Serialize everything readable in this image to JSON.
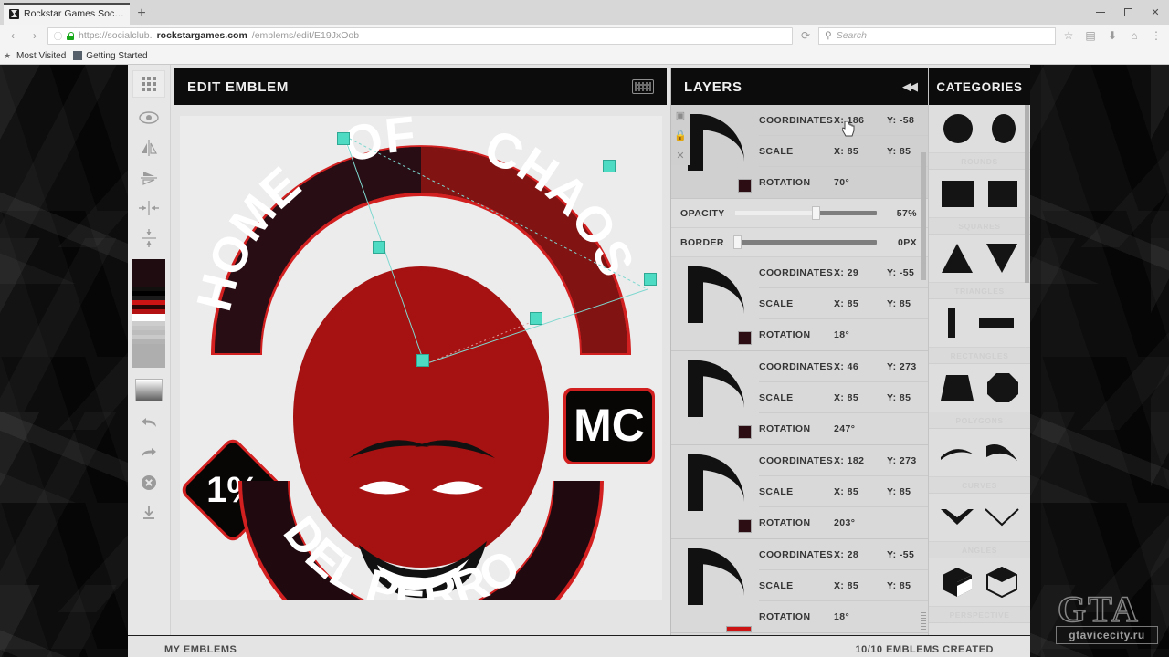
{
  "browser": {
    "tab_title": "Rockstar Games Social Club",
    "new_tab_label": "+",
    "url_scheme": "https://socialclub.",
    "url_host": "rockstargames.com",
    "url_path": "/emblems/edit/E19JxOob",
    "search_placeholder": "Search",
    "reload_icon": "reload-icon",
    "bookmarks": [
      {
        "label": "Most Visited",
        "icon": "star-icon"
      },
      {
        "label": "Getting Started",
        "icon": "bookmark-folder-icon"
      }
    ]
  },
  "editor": {
    "title": "EDIT EMBLEM",
    "keyboard_icon": "keyboard-icon",
    "tools": [
      {
        "name": "grid-toggle",
        "icon": "grid-icon"
      },
      {
        "name": "visibility-toggle",
        "icon": "eye-icon"
      },
      {
        "name": "flip-horizontal",
        "icon": "flip-horizontal-icon"
      },
      {
        "name": "flip-vertical",
        "icon": "flip-vertical-icon"
      },
      {
        "name": "align-center-horizontal",
        "icon": "align-center-horizontal-icon"
      },
      {
        "name": "align-center-vertical",
        "icon": "align-center-vertical-icon"
      }
    ],
    "swatches": [
      "#1e0c10",
      "#12100f",
      "#000000",
      "#cc1414",
      "#b41212",
      "#ffffff",
      "#c9c9c9",
      "#bdbdbd",
      "#b2b2b2",
      "#a8a8a8",
      "#9f9f9f"
    ],
    "gradient_button": "gradient-picker",
    "actions": [
      {
        "name": "undo",
        "icon": "undo-icon"
      },
      {
        "name": "redo",
        "icon": "redo-icon"
      },
      {
        "name": "clear",
        "icon": "clear-circle-icon"
      },
      {
        "name": "download",
        "icon": "download-icon"
      }
    ]
  },
  "emblem": {
    "top_arc_text": "HOME",
    "top_center_text": "OF",
    "top_right_text": "CHAOS",
    "badge_left": "1%",
    "badge_right": "MC",
    "bottom_arc_text": "DEL PERRO",
    "colors": {
      "red": "#a61111",
      "dark": "#1b0a0f",
      "outline": "#d21f1f",
      "canvas": "#ececed"
    }
  },
  "layers": {
    "title": "LAYERS",
    "collapse_icon": "collapse-left-icon",
    "controls": [
      {
        "name": "duplicate-layer",
        "icon": "duplicate-icon"
      },
      {
        "name": "lock-layer",
        "icon": "lock-icon"
      },
      {
        "name": "delete-layer",
        "icon": "close-icon"
      }
    ],
    "labels": {
      "coordinates": "COORDINATES",
      "scale": "SCALE",
      "rotation": "ROTATION",
      "opacity": "OPACITY",
      "border": "BORDER",
      "x": "X:",
      "y": "Y:"
    },
    "items": [
      {
        "selected": true,
        "coord_x": "186",
        "coord_y": "-58",
        "scale_x": "85",
        "scale_y": "85",
        "rotation": "70°",
        "color": "#2b0d13",
        "opacity_label": "OPACITY",
        "opacity_value": "57%",
        "opacity_percent": 57,
        "border_label": "BORDER",
        "border_value": "0PX",
        "border_percent": 0
      },
      {
        "selected": false,
        "coord_x": "29",
        "coord_y": "-55",
        "scale_x": "85",
        "scale_y": "85",
        "rotation": "18°",
        "color": "#2b0d13"
      },
      {
        "selected": false,
        "coord_x": "46",
        "coord_y": "273",
        "scale_x": "85",
        "scale_y": "85",
        "rotation": "247°",
        "color": "#2b0d13"
      },
      {
        "selected": false,
        "coord_x": "182",
        "coord_y": "273",
        "scale_x": "85",
        "scale_y": "85",
        "rotation": "203°",
        "color": "#2b0d13"
      },
      {
        "selected": false,
        "coord_x": "28",
        "coord_y": "-55",
        "scale_x": "85",
        "scale_y": "85",
        "rotation": "18°",
        "color": "#cc1414"
      }
    ]
  },
  "categories": {
    "title": "CATEGORIES",
    "items": [
      {
        "label": "ROUNDS",
        "shapes": [
          "circle",
          "ellipse"
        ]
      },
      {
        "label": "SQUARES",
        "shapes": [
          "square",
          "square-outline"
        ]
      },
      {
        "label": "TRIANGLES",
        "shapes": [
          "triangle-up",
          "triangle-down"
        ]
      },
      {
        "label": "RECTANGLES",
        "shapes": [
          "bar-vertical",
          "bar-horizontal"
        ]
      },
      {
        "label": "POLYGONS",
        "shapes": [
          "trapezoid",
          "octagon"
        ]
      },
      {
        "label": "CURVES",
        "shapes": [
          "curve-thin",
          "curve-thick"
        ]
      },
      {
        "label": "ANGLES",
        "shapes": [
          "chevron-bold",
          "chevron-thin"
        ]
      },
      {
        "label": "PERSPECTIVE",
        "shapes": [
          "cube-solid",
          "cube-outline"
        ]
      }
    ]
  },
  "footer": {
    "my_emblems": "MY EMBLEMS",
    "count": "10/10 EMBLEMS CREATED"
  },
  "watermark": {
    "logo": "GTA",
    "site": "gtavicecity.ru"
  }
}
